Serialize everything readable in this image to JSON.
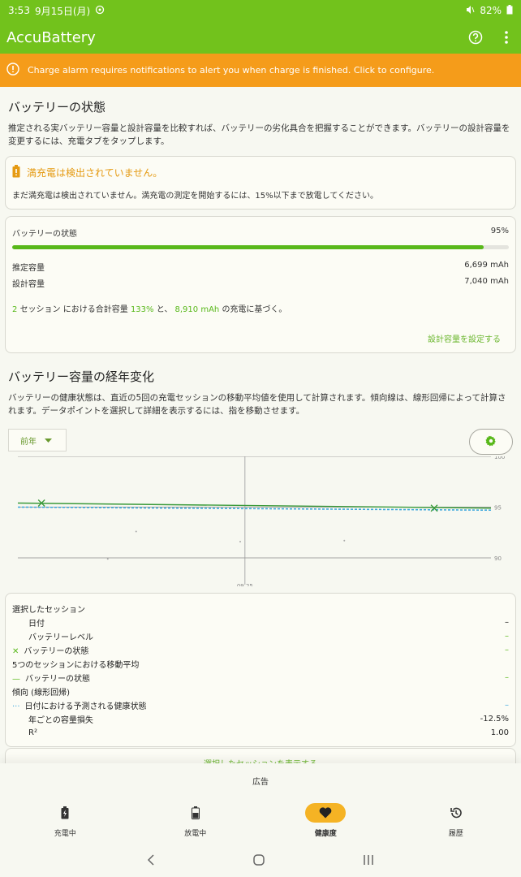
{
  "status_bar": {
    "time": "3:53",
    "date": "9月15日(月)",
    "battery": "82%"
  },
  "app_bar": {
    "title": "AccuBattery"
  },
  "alarm": {
    "text": "Charge alarm requires notifications to alert you when charge is finished. Click to configure."
  },
  "battery_status": {
    "title": "バッテリーの状態",
    "description": "推定される実バッテリー容量と設計容量を比較すれば、バッテリーの劣化具合を把握することができます。バッテリーの設計容量を変更するには、充電タブをタップします。"
  },
  "full_charge": {
    "title": "満充電は検出されていません。",
    "description": "まだ満充電は検出されていません。満充電の測定を開始するには、15%以下まで放電してください。"
  },
  "health": {
    "label": "バッテリーの状態",
    "percent": "95%",
    "percent_value": 95,
    "estimated_label": "推定容量",
    "estimated_value": "6,699 mAh",
    "design_label": "設計容量",
    "design_value": "7,040 mAh",
    "note_sessions": "2",
    "note_part1": "セッション における合計容量",
    "note_total": "133%",
    "note_part2": "と、",
    "note_mah": "8,910 mAh",
    "note_part3": "の充電に基づく。",
    "set_capacity_link": "設計容量を設定する"
  },
  "history": {
    "title": "バッテリー容量の経年変化",
    "description": "バッテリーの健康状態は、直近の5回の充電セッションの移動平均値を使用して計算されます。傾向線は、線形回帰によって計算されます。データポイントを選択して詳細を表示するには、指を移動させます。",
    "period": "前年"
  },
  "chart_data": {
    "type": "line",
    "x_tick": "09.25",
    "y_ticks": [
      100,
      95,
      90
    ],
    "ylim": [
      88,
      100
    ],
    "grid": true,
    "series": [
      {
        "values": [
          95.4,
          94.9
        ],
        "color": "#3a9a3a"
      },
      {
        "values": [
          95.0,
          94.7
        ],
        "color": "#3fa9dd"
      }
    ],
    "points": [
      {
        "x": 0.05,
        "y": 95.4,
        "marker": "x"
      },
      {
        "x": 0.88,
        "y": 94.9,
        "marker": "x"
      },
      {
        "x": 0.25,
        "y": 92.6,
        "marker": "dot"
      },
      {
        "x": 0.19,
        "y": 89.9,
        "marker": "dot"
      },
      {
        "x": 0.47,
        "y": 91.6,
        "marker": "dot"
      },
      {
        "x": 0.69,
        "y": 91.7,
        "marker": "dot"
      }
    ]
  },
  "session": {
    "selected_title": "選択したセッション",
    "date_label": "日付",
    "date_value": "–",
    "level_label": "バッテリーレベル",
    "level_value": "–",
    "health_label": "バッテリーの状態",
    "health_value": "–",
    "moving_avg_title": "5つのセッションにおける移動平均",
    "moving_health_label": "バッテリーの状態",
    "moving_health_value": "–",
    "trend_title": "傾向 (線形回帰)",
    "predicted_label": "日付における予測される健康状態",
    "predicted_value": "–",
    "loss_label": "年ごとの容量損失",
    "loss_value": "-12.5%",
    "r2_label": "R²",
    "r2_value": "1.00",
    "show_link": "選択したセッションを表示する"
  },
  "ad": {
    "label": "広告"
  },
  "nav": {
    "charging": "充電中",
    "discharging": "放電中",
    "health": "健康度",
    "history": "履歴"
  },
  "colors": {
    "green": "#72c21c",
    "orange": "#f59c1a",
    "accent": "#58b81a",
    "highlight": "#f5b324"
  }
}
